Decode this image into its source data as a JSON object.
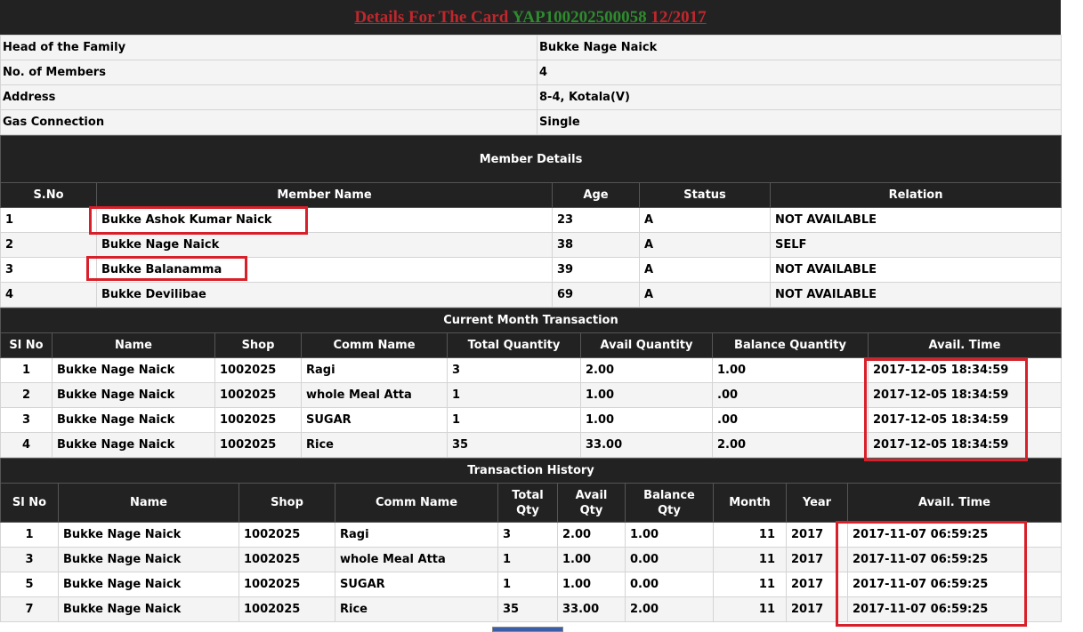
{
  "title": {
    "prefix": "Details For The Card ",
    "card_no": "YAP100202500058",
    "period": " 12/2017"
  },
  "info": [
    {
      "label": "Head of the Family",
      "value": "Bukke Nage Naick"
    },
    {
      "label": "No. of Members",
      "value": "4"
    },
    {
      "label": "Address",
      "value": "8-4, Kotala(V)"
    },
    {
      "label": "Gas Connection",
      "value": "Single"
    }
  ],
  "members": {
    "title": "Member Details",
    "headers": [
      "S.No",
      "Member Name",
      "Age",
      "Status",
      "Relation"
    ],
    "rows": [
      [
        "1",
        "Bukke Ashok Kumar Naick",
        "23",
        "A",
        "NOT AVAILABLE"
      ],
      [
        "2",
        "Bukke Nage Naick",
        "38",
        "A",
        "SELF"
      ],
      [
        "3",
        "Bukke Balanamma",
        "39",
        "A",
        "NOT AVAILABLE"
      ],
      [
        "4",
        "Bukke Devilibae",
        "69",
        "A",
        "NOT AVAILABLE"
      ]
    ]
  },
  "current": {
    "title": "Current Month Transaction",
    "headers": [
      "Sl No",
      "Name",
      "Shop",
      "Comm Name",
      "Total Quantity",
      "Avail Quantity",
      "Balance Quantity",
      "Avail. Time"
    ],
    "rows": [
      [
        "1",
        "Bukke Nage Naick",
        "1002025",
        "Ragi",
        "3",
        "2.00",
        "1.00",
        "2017-12-05 18:34:59"
      ],
      [
        "2",
        "Bukke Nage Naick",
        "1002025",
        "whole Meal Atta",
        "1",
        "1.00",
        ".00",
        "2017-12-05 18:34:59"
      ],
      [
        "3",
        "Bukke Nage Naick",
        "1002025",
        "SUGAR",
        "1",
        "1.00",
        ".00",
        "2017-12-05 18:34:59"
      ],
      [
        "4",
        "Bukke Nage Naick",
        "1002025",
        "Rice",
        "35",
        "33.00",
        "2.00",
        "2017-12-05 18:34:59"
      ]
    ]
  },
  "history": {
    "title": "Transaction History",
    "headers": [
      "Sl No",
      "Name",
      "Shop",
      "Comm Name",
      "Total\nQty",
      "Avail\nQty",
      "Balance\nQty",
      "Month",
      "Year",
      "Avail. Time"
    ],
    "rows": [
      [
        "1",
        "Bukke Nage Naick",
        "1002025",
        "Ragi",
        "3",
        "2.00",
        "1.00",
        "11",
        "2017",
        "2017-11-07 06:59:25"
      ],
      [
        "3",
        "Bukke Nage Naick",
        "1002025",
        "whole Meal Atta",
        "1",
        "1.00",
        "0.00",
        "11",
        "2017",
        "2017-11-07 06:59:25"
      ],
      [
        "5",
        "Bukke Nage Naick",
        "1002025",
        "SUGAR",
        "1",
        "1.00",
        "0.00",
        "11",
        "2017",
        "2017-11-07 06:59:25"
      ],
      [
        "7",
        "Bukke Nage Naick",
        "1002025",
        "Rice",
        "35",
        "33.00",
        "2.00",
        "11",
        "2017",
        "2017-11-07 06:59:25"
      ]
    ]
  },
  "colors": {
    "header_bg": "#222222",
    "title_red": "#c0272d",
    "card_green": "#2e8b2e",
    "highlight": "#d8202a"
  }
}
